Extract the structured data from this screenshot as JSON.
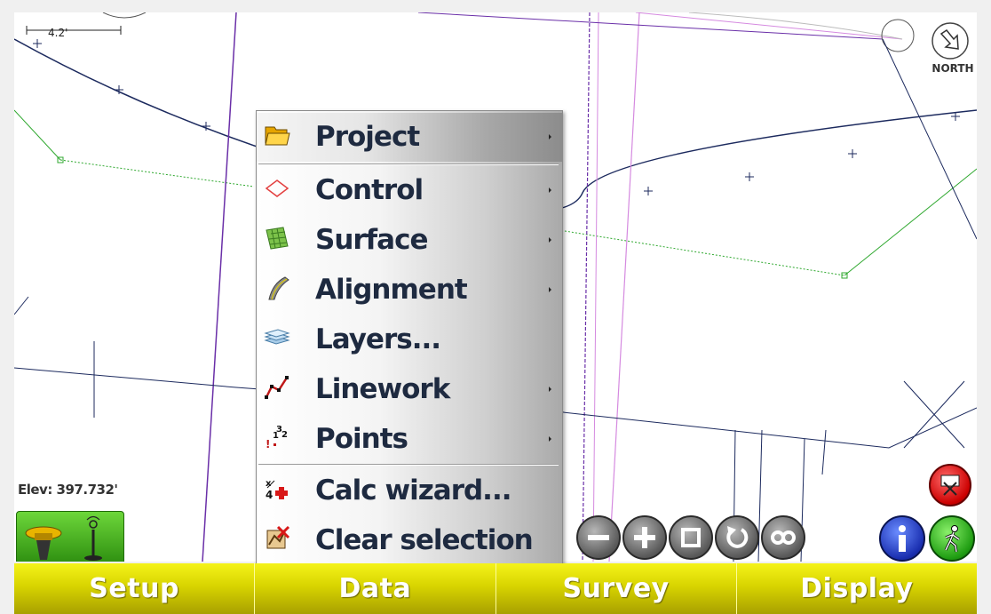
{
  "map": {
    "scale_label": "4.2'",
    "north_label": "NORTH",
    "elevation": "Elev: 397.732'"
  },
  "menu": {
    "items": [
      {
        "label": "Project",
        "icon": "folder-icon",
        "submenu": true
      },
      {
        "label": "Control",
        "icon": "control-icon",
        "submenu": true
      },
      {
        "label": "Surface",
        "icon": "surface-icon",
        "submenu": true
      },
      {
        "label": "Alignment",
        "icon": "alignment-icon",
        "submenu": true
      },
      {
        "label": "Layers...",
        "icon": "layers-icon",
        "submenu": false
      },
      {
        "label": "Linework",
        "icon": "linework-icon",
        "submenu": true
      },
      {
        "label": "Points",
        "icon": "points-icon",
        "submenu": true
      },
      {
        "label": "Calc wizard...",
        "icon": "calc-wizard-icon",
        "submenu": false
      },
      {
        "label": "Clear selection",
        "icon": "clear-selection-icon",
        "submenu": false
      }
    ],
    "selected": "Project"
  },
  "toolbar": {
    "zoom_buttons": [
      "zoom-out-icon",
      "zoom-in-icon",
      "zoom-window-icon",
      "zoom-previous-icon",
      "zoom-extents-icon"
    ]
  },
  "bottom_tabs": [
    "Setup",
    "Data",
    "Survey",
    "Display"
  ],
  "colors": {
    "tab_yellow": "#d8d400",
    "menu_text": "#1e2a40",
    "boundary_purple": "#6a2fa8",
    "alignment_navy": "#1c2a5e",
    "offset_green": "#2fa82f"
  }
}
